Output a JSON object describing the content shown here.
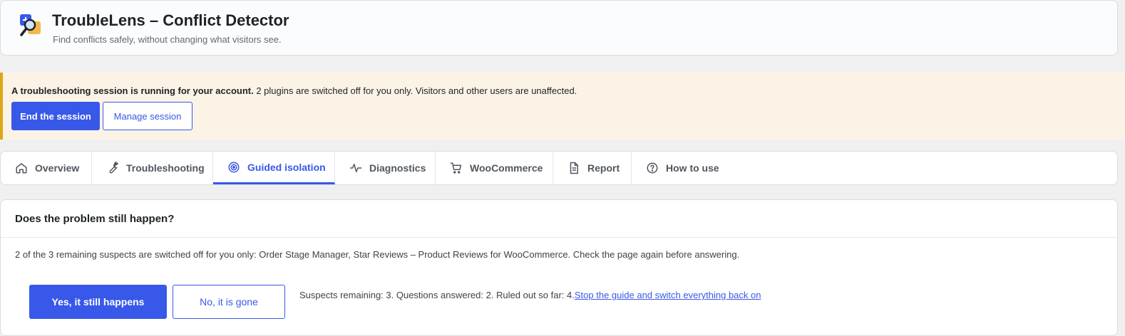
{
  "header": {
    "title": "TroubleLens – Conflict Detector",
    "subtitle": "Find conflicts safely, without changing what visitors see."
  },
  "notice": {
    "bold_text": "A troubleshooting session is running for your account.",
    "text": " 2 plugins are switched off for you only. Visitors and other users are unaffected.",
    "end_label": "End the session",
    "manage_label": "Manage session"
  },
  "tabs": [
    {
      "label": "Overview",
      "icon": "home-icon"
    },
    {
      "label": "Troubleshooting",
      "icon": "wrench-icon"
    },
    {
      "label": "Guided isolation",
      "icon": "target-icon",
      "active": true
    },
    {
      "label": "Diagnostics",
      "icon": "pulse-icon"
    },
    {
      "label": "WooCommerce",
      "icon": "cart-icon"
    },
    {
      "label": "Report",
      "icon": "document-icon"
    },
    {
      "label": "How to use",
      "icon": "help-icon"
    }
  ],
  "guide": {
    "question": "Does the problem still happen?",
    "description": "2 of the 3 remaining suspects are switched off for you only: Order Stage Manager, Star Reviews – Product Reviews for WooCommerce. Check the page again before answering.",
    "yes_label": "Yes, it still happens",
    "no_label": "No, it is gone",
    "status": "Suspects remaining: 3. Questions answered: 2. Ruled out so far: 4.",
    "stop_link": "Stop the guide and switch everything back on"
  },
  "colors": {
    "accent": "#3858e9",
    "notice_bg": "#fcf3e7",
    "notice_border": "#dba617"
  }
}
